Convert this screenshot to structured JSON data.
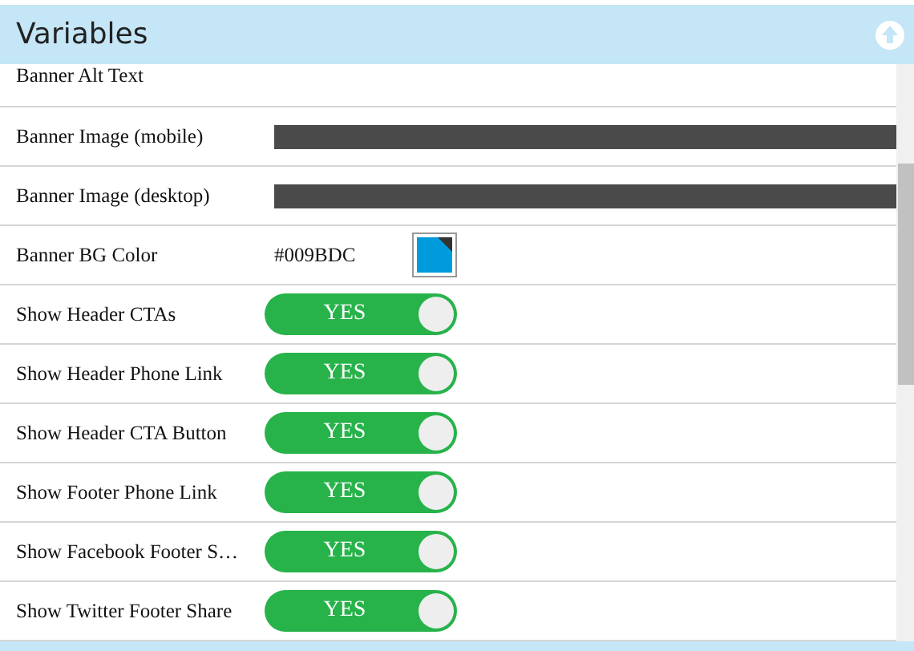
{
  "panel": {
    "title": "Variables"
  },
  "rows": [
    {
      "kind": "text",
      "label": "Banner Alt Text"
    },
    {
      "kind": "image",
      "label": "Banner Image (mobile)"
    },
    {
      "kind": "image",
      "label": "Banner Image (desktop)"
    },
    {
      "kind": "color",
      "label": "Banner BG Color",
      "value": "#009BDC",
      "color": "#009bdc"
    },
    {
      "kind": "toggle",
      "label": "Show Header CTAs",
      "on": true,
      "text": "YES"
    },
    {
      "kind": "toggle",
      "label": "Show Header Phone Link",
      "on": true,
      "text": "YES"
    },
    {
      "kind": "toggle",
      "label": "Show Header CTA Button",
      "on": true,
      "text": "YES"
    },
    {
      "kind": "toggle",
      "label": "Show Footer Phone Link",
      "on": true,
      "text": "YES"
    },
    {
      "kind": "toggle",
      "label": "Show Facebook Footer S…",
      "on": true,
      "text": "YES"
    },
    {
      "kind": "toggle",
      "label": "Show Twitter Footer Share",
      "on": true,
      "text": "YES"
    }
  ]
}
